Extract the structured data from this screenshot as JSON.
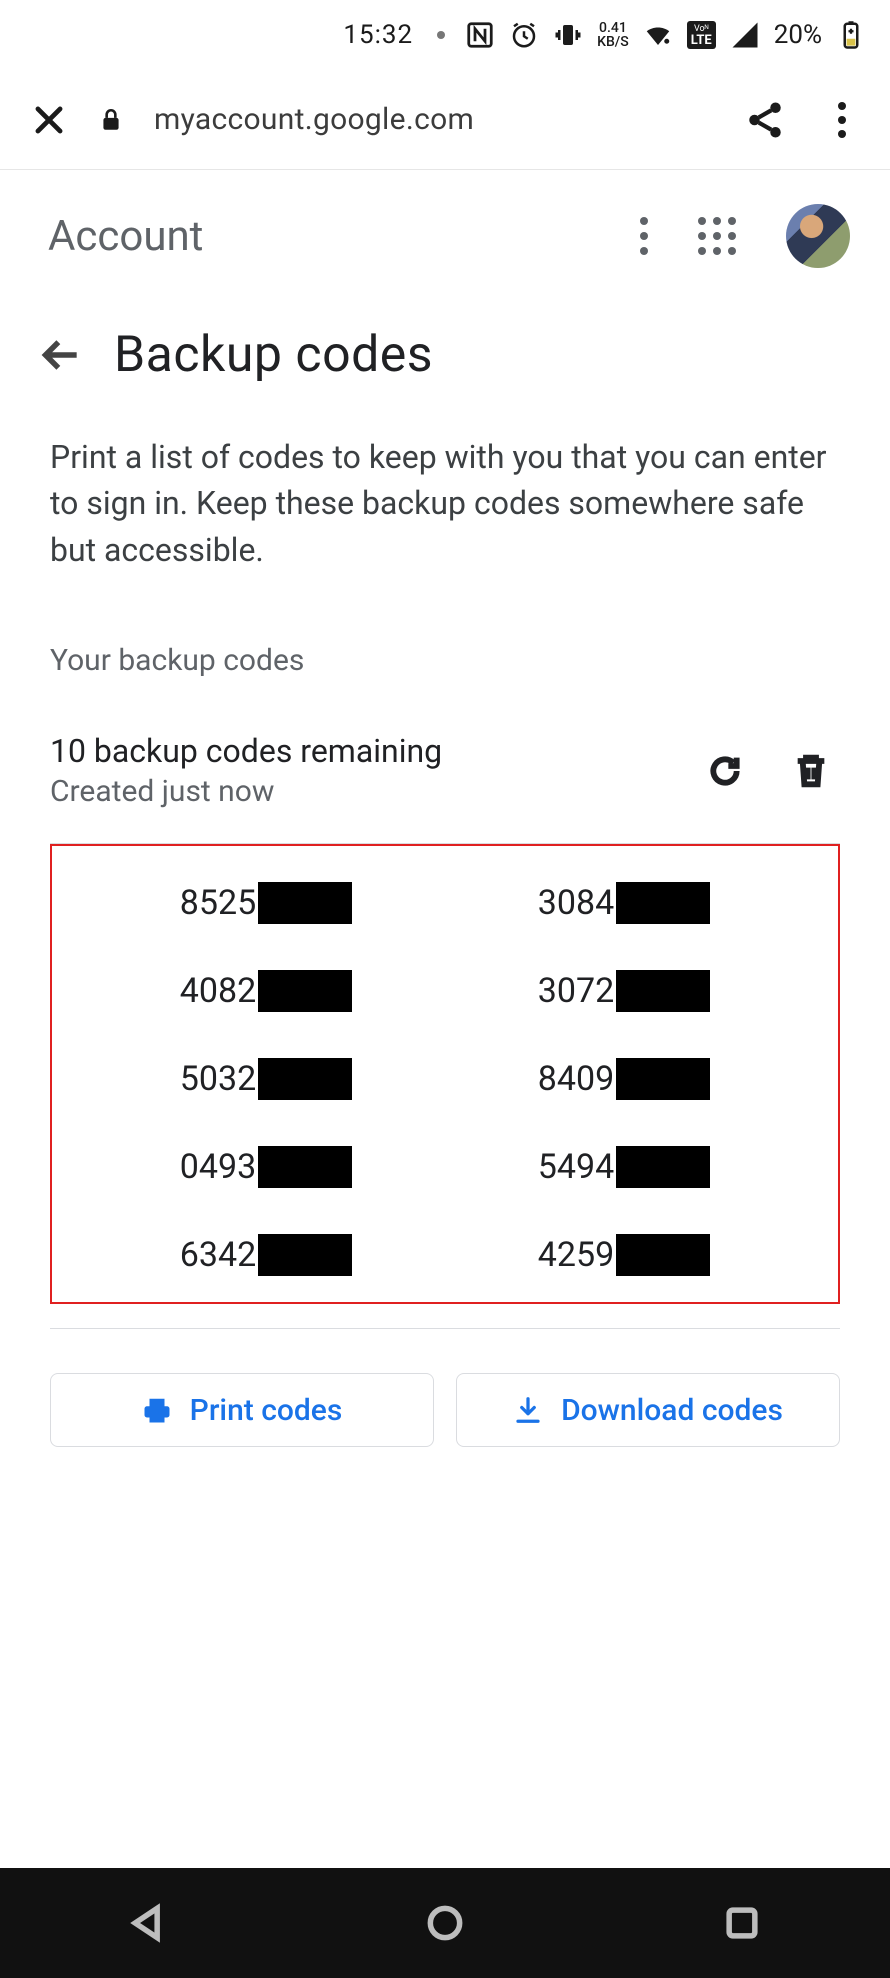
{
  "status_bar": {
    "time": "15:32",
    "net_rate_value": "0.41",
    "net_rate_unit": "KB/S",
    "volte_top": "Voᴺ",
    "volte_bottom": "LTE",
    "battery_pct": "20%"
  },
  "url_bar": {
    "host": "myaccount.google.com"
  },
  "app_header": {
    "title": "Account"
  },
  "page": {
    "title": "Backup codes",
    "description": "Print a list of codes to keep with you that you can enter to sign in. Keep these backup codes some­where safe but accessible.",
    "section_label": "Your backup codes",
    "remaining": "10 backup codes remaining",
    "created": "Created just now"
  },
  "codes": {
    "left": [
      "8525",
      "4082",
      "5032",
      "0493",
      "6342"
    ],
    "right": [
      "3084",
      "3072",
      "8409",
      "5494",
      "4259"
    ]
  },
  "actions": {
    "print": "Print codes",
    "download": "Download codes"
  }
}
